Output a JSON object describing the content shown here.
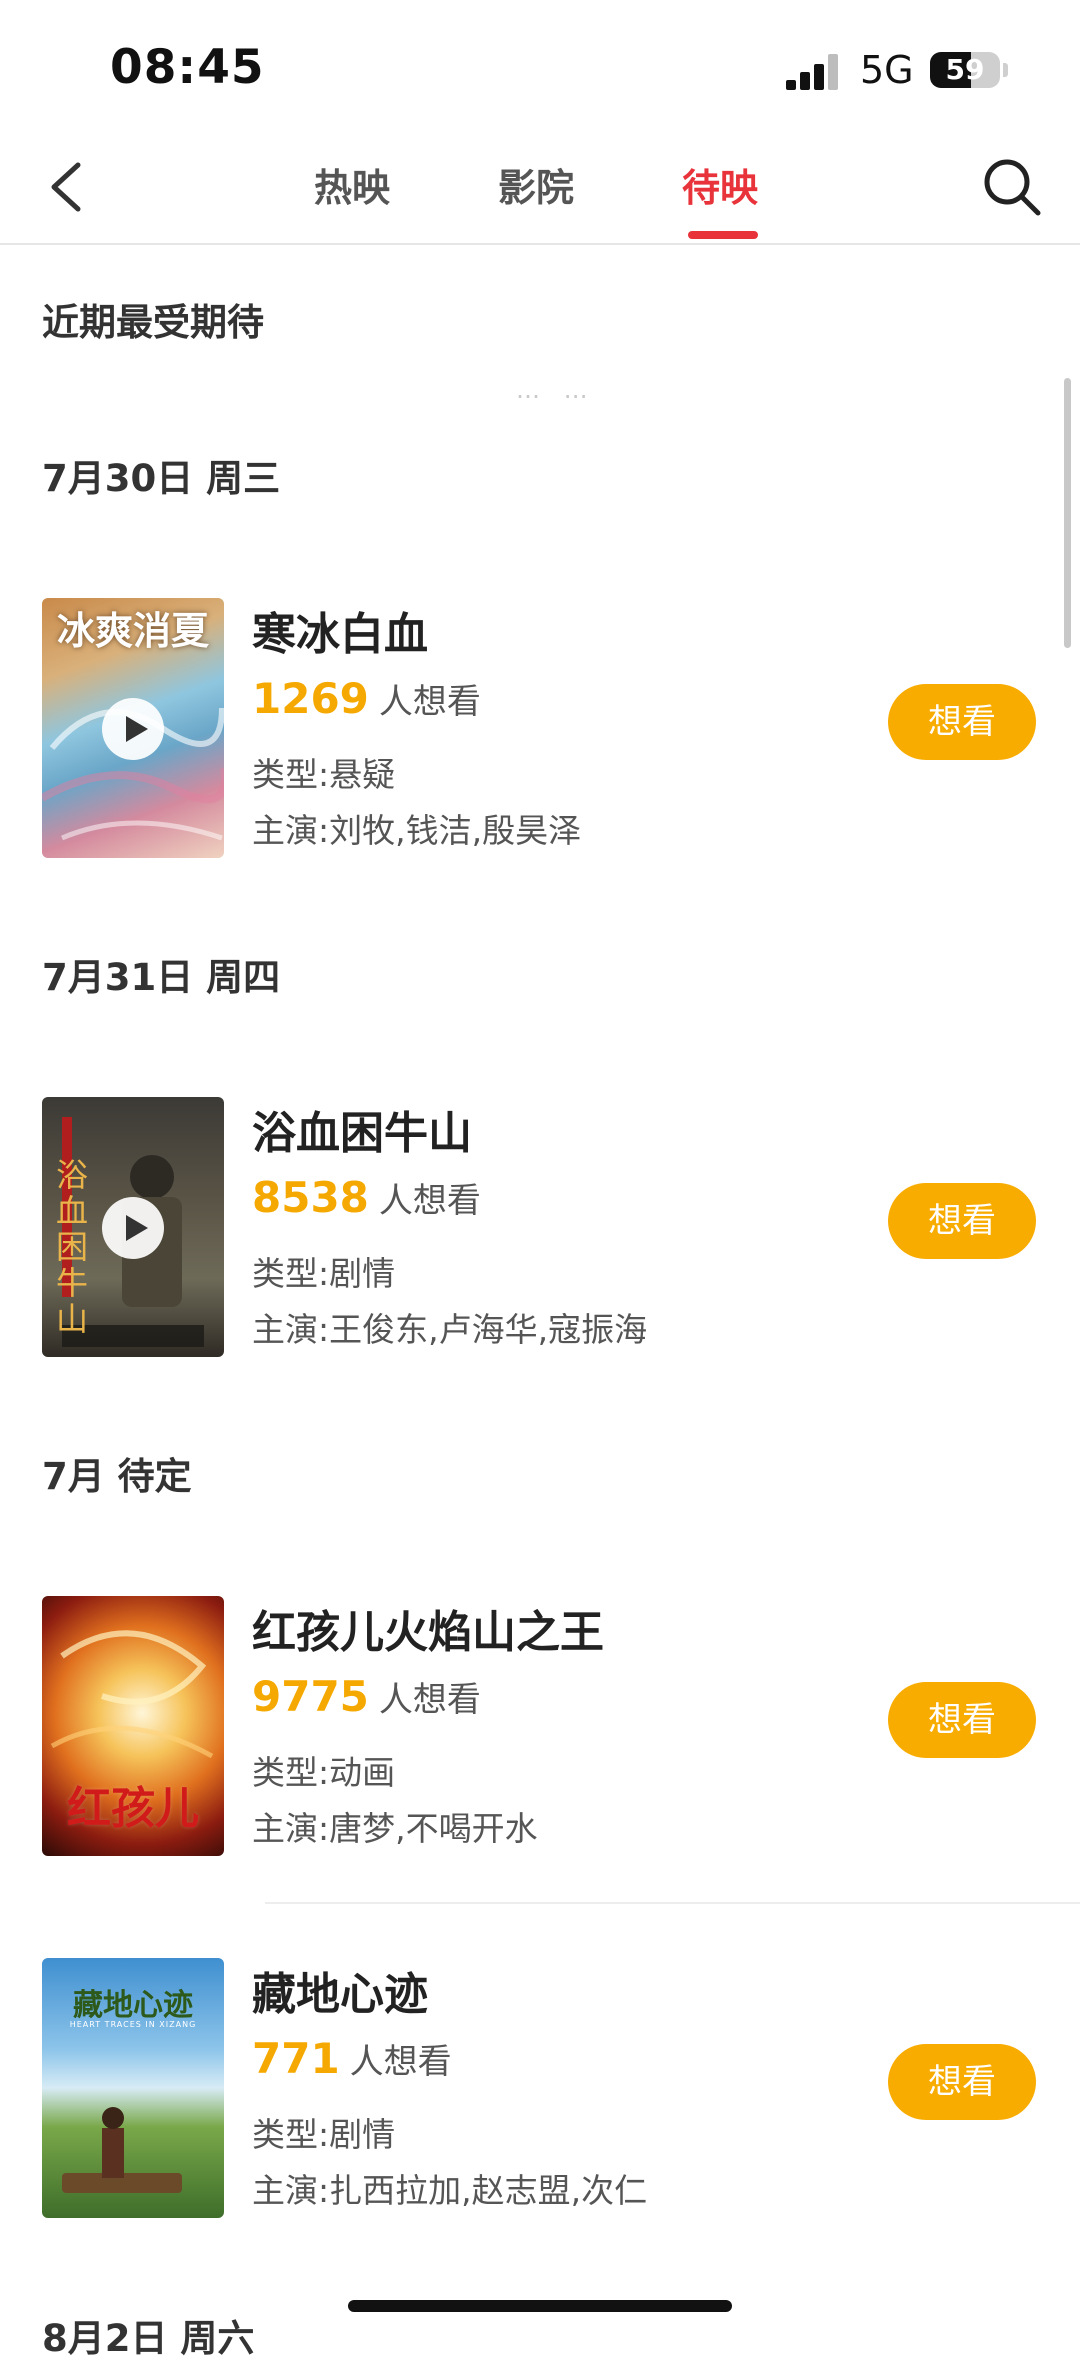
{
  "status_bar": {
    "time": "08:45",
    "network": "5G",
    "battery": "59",
    "battery_level": 0.59
  },
  "nav": {
    "tabs": [
      "热映",
      "影院",
      "待映"
    ],
    "active_tab": "待映"
  },
  "section_title": "近期最受期待",
  "faded_text": "…  …",
  "groups": [
    {
      "date": "7月30日 周三",
      "movies": [
        {
          "title": "寒冰白血",
          "count": "1269",
          "want_suffix": "人想看",
          "genre": "类型:悬疑",
          "cast": "主演:刘牧,钱洁,殷昊泽",
          "button": "想看",
          "poster_text": "冰爽消夏",
          "has_play": true
        }
      ]
    },
    {
      "date": "7月31日 周四",
      "movies": [
        {
          "title": "浴血困牛山",
          "count": "8538",
          "want_suffix": "人想看",
          "genre": "类型:剧情",
          "cast": "主演:王俊东,卢海华,寇振海",
          "button": "想看",
          "poster_text": "浴血困牛山",
          "has_play": true
        }
      ]
    },
    {
      "date": "7月 待定",
      "movies": [
        {
          "title": "红孩儿火焰山之王",
          "count": "9775",
          "want_suffix": "人想看",
          "genre": "类型:动画",
          "cast": "主演:唐梦,不喝开水",
          "button": "想看",
          "poster_text": "红孩儿",
          "has_play": false
        },
        {
          "title": "藏地心迹",
          "count": "771",
          "want_suffix": "人想看",
          "genre": "类型:剧情",
          "cast": "主演:扎西拉加,赵志盟,次仁",
          "button": "想看",
          "poster_text": "藏地心迹",
          "poster_subtext": "HEART TRACES IN XIZANG",
          "has_play": false
        }
      ]
    },
    {
      "date": "8月2日 周六",
      "movies": []
    }
  ],
  "colors": {
    "accent_red": "#e8333a",
    "want_yellow": "#f9ac00",
    "count_yellow": "#f5a900"
  }
}
